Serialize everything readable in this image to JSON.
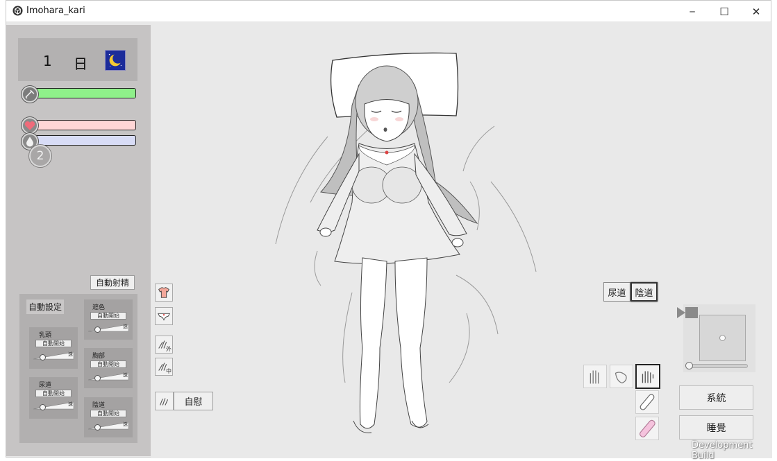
{
  "window": {
    "title": "Imohara_kari",
    "minimize_glyph": "─",
    "maximize_glyph": "☐",
    "close_glyph": "✕"
  },
  "status": {
    "day_number": "1",
    "day_label": "日",
    "time_icon": "crescent-moon-icon",
    "stamina_fraction": 1.0,
    "excitement_fraction": 0.0,
    "fluid_fraction": 0.0,
    "counter": "2"
  },
  "left_panel": {
    "auto_ejaculate_label": "自動射精",
    "auto_settings_label": "自動設定",
    "sections": [
      {
        "label": "乳頭",
        "button": "自動開始",
        "tag": "速",
        "level": 0.25
      },
      {
        "label": "尿道",
        "button": "自動開始",
        "tag": "速",
        "level": 0.25
      },
      {
        "label": "遮色",
        "button": "自動開始",
        "tag": "速",
        "level": 0.25
      },
      {
        "label": "胸部",
        "button": "自動開始",
        "tag": "速",
        "level": 0.25
      },
      {
        "label": "陰道",
        "button": "自動開始",
        "tag": "速",
        "level": 0.25
      }
    ]
  },
  "action_icons": {
    "top_clothes": "shirt-icon",
    "underwear": "panties-icon",
    "hand_outside_label": "外",
    "hand_inside_label": "中",
    "masturbate_label": "自慰"
  },
  "target_toggle": {
    "urethra": "尿道",
    "vagina": "陰道"
  },
  "camera": {
    "zoom_level": 0.0
  },
  "buttons": {
    "system": "系統",
    "sleep": "睡覺"
  },
  "footer": {
    "dev_build": "Development Build"
  },
  "colors": {
    "stamina": "#8ff08a",
    "excitement": "#ffd6d6",
    "fluid": "#d8dcf6",
    "moon_bg": "#1c2c9a",
    "panel": "#c6c4c4"
  }
}
